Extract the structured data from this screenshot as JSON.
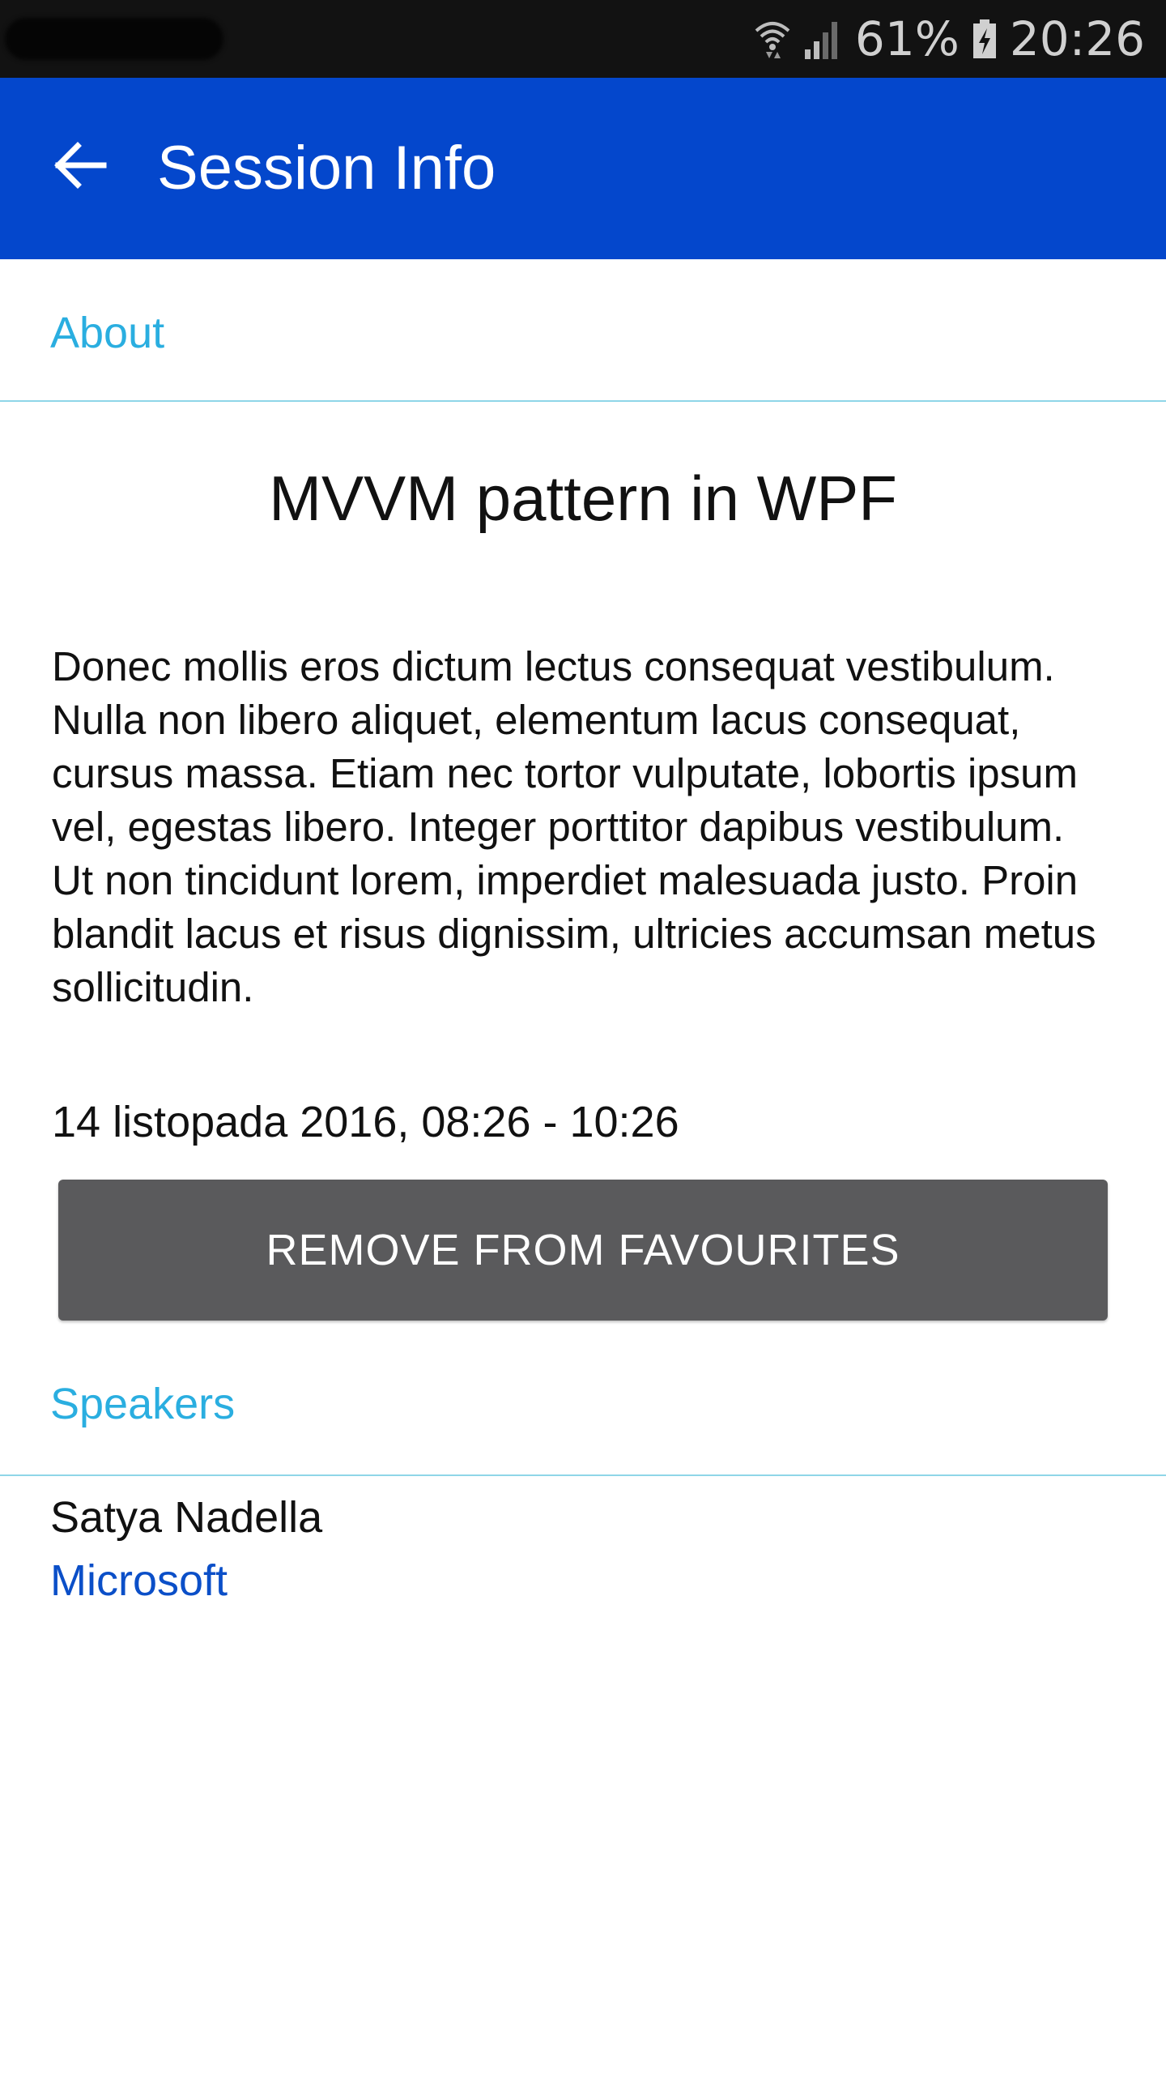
{
  "status_bar": {
    "battery_percent": "61%",
    "time": "20:26",
    "icons": [
      "wifi-icon",
      "signal-icon",
      "battery-charging-icon"
    ]
  },
  "app_bar": {
    "back_icon": "arrow-left-icon",
    "title": "Session Info"
  },
  "about_section": {
    "header": "About",
    "session_title": "MVVM pattern in WPF",
    "description": "Donec mollis eros dictum lectus consequat vestibulum. Nulla non libero aliquet, elementum lacus consequat, cursus massa. Etiam nec tortor vulputate, lobortis ipsum vel, egestas libero. Integer porttitor dapibus vestibulum. Ut non tincidunt lorem, imperdiet malesuada justo. Proin blandit lacus et risus dignissim, ultricies accumsan metus sollicitudin.",
    "datetime": "14 listopada 2016, 08:26 - 10:26",
    "remove_button_label": "REMOVE FROM FAVOURITES"
  },
  "speakers_section": {
    "header": "Speakers",
    "speakers": [
      {
        "name": "Satya Nadella",
        "company": "Microsoft"
      }
    ]
  },
  "colors": {
    "app_bar": "#0447cc",
    "section_header": "#2aaee0",
    "button": "#5a5a5c",
    "company_link": "#0b4fc8"
  }
}
